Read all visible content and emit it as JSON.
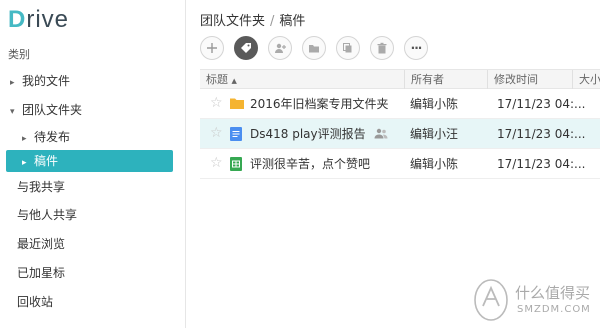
{
  "app": {
    "logo": "Drive"
  },
  "sidebar": {
    "category_label": "类别",
    "items": [
      {
        "label": "我的文件",
        "caret": "▸"
      },
      {
        "label": "团队文件夹",
        "caret": "▾"
      },
      {
        "label": "待发布",
        "caret": "▸"
      },
      {
        "label": "稿件",
        "caret": "▸"
      },
      {
        "label": "与我共享"
      },
      {
        "label": "与他人共享"
      },
      {
        "label": "最近浏览"
      },
      {
        "label": "已加星标"
      },
      {
        "label": "回收站"
      }
    ]
  },
  "breadcrumb": {
    "parent": "团队文件夹",
    "separator": "/",
    "current": "稿件"
  },
  "toolbar": {
    "icons": [
      "plus-icon",
      "tag-icon",
      "add-user-icon",
      "move-folder-icon",
      "copy-icon",
      "delete-icon",
      "more-icon"
    ],
    "more_label": "···"
  },
  "table": {
    "headers": {
      "title": "标题",
      "sort": "▲",
      "owner": "所有者",
      "modified": "修改时间",
      "size": "大小"
    },
    "rows": [
      {
        "name": "2016年旧档案专用文件夹",
        "type": "folder",
        "owner": "编辑小陈",
        "modified": "17/11/23 04:...",
        "shared": false,
        "selected": false
      },
      {
        "name": "Ds418 play评测报告",
        "type": "document",
        "owner": "编辑小汪",
        "modified": "17/11/23 04:...",
        "shared": true,
        "selected": true
      },
      {
        "name": "评测很辛苦，点个赞吧",
        "type": "spreadsheet",
        "owner": "编辑小陈",
        "modified": "17/11/23 04:...",
        "shared": false,
        "selected": false
      }
    ]
  },
  "watermark": {
    "line1": "什么值得买",
    "line2": "SMZDM.COM"
  },
  "colors": {
    "accent": "#2db2bd",
    "folder": "#f5b431",
    "document": "#4a8ef0",
    "spreadsheet": "#36a852",
    "selected_row": "#e7f6f7"
  }
}
